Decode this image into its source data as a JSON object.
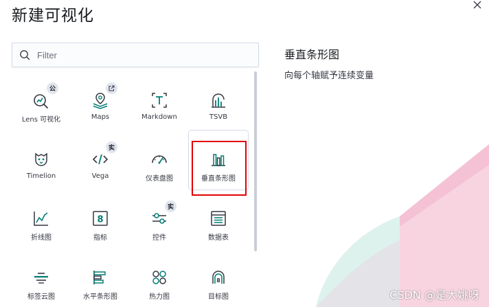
{
  "modal": {
    "title": "新建可视化"
  },
  "search": {
    "placeholder": "Filter",
    "value": ""
  },
  "tiles": [
    {
      "label": "Lens 可视化",
      "icon": "lens-icon",
      "badge": "公"
    },
    {
      "label": "Maps",
      "icon": "maps-icon",
      "badge": "external-link-icon"
    },
    {
      "label": "Markdown",
      "icon": "markdown-icon"
    },
    {
      "label": "TSVB",
      "icon": "tsvb-icon"
    },
    {
      "label": "Timelion",
      "icon": "timelion-icon"
    },
    {
      "label": "Vega",
      "icon": "vega-icon",
      "badge": "实"
    },
    {
      "label": "仪表盘图",
      "icon": "gauge-icon"
    },
    {
      "label": "垂直条形图",
      "icon": "vertical-bar-icon"
    },
    {
      "label": "折线图",
      "icon": "line-chart-icon"
    },
    {
      "label": "指标",
      "icon": "metric-icon"
    },
    {
      "label": "控件",
      "icon": "controls-icon",
      "badge": "实"
    },
    {
      "label": "数据表",
      "icon": "data-table-icon"
    },
    {
      "label": "标签云图",
      "icon": "tag-cloud-icon"
    },
    {
      "label": "水平条形图",
      "icon": "horizontal-bar-icon"
    },
    {
      "label": "热力图",
      "icon": "heatmap-icon"
    },
    {
      "label": "目标图",
      "icon": "goal-icon"
    }
  ],
  "selected": {
    "title": "垂直条形图",
    "description": "向每个轴赋予连续变量"
  },
  "watermark": "CSDN @是大姚呀",
  "colors": {
    "icon_teal": "#017d73",
    "highlight": "#e30000",
    "text": "#343741",
    "title": "#1a1c21"
  }
}
